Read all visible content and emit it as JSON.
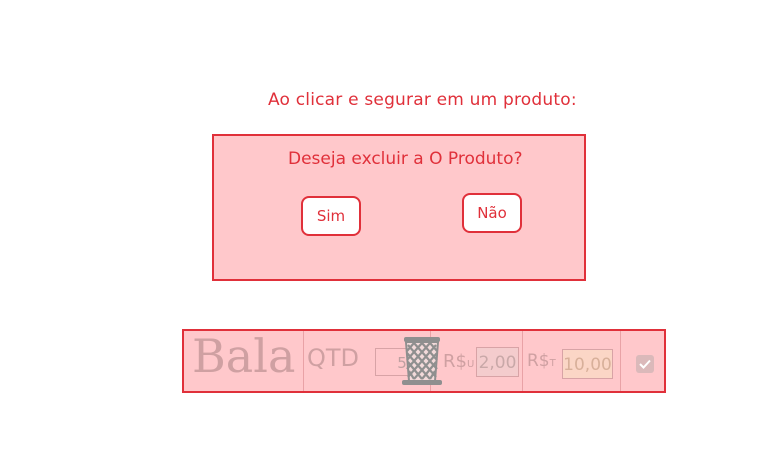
{
  "caption": "Ao clicar e segurar em um produto:",
  "dialog": {
    "question": "Deseja excluir a O Produto?",
    "yes_label": "Sim",
    "no_label": "Não"
  },
  "product_row": {
    "name": "Bala",
    "qty_label": "QTD",
    "qty_value": "5",
    "unit_label": "R$",
    "unit_sub": "U",
    "unit_price": "2,00",
    "total_label": "R$",
    "total_sub": "T",
    "total_price": "10,00",
    "checked": true
  },
  "colors": {
    "accent": "#e0303a",
    "panel_bg": "#ffc8cb",
    "trash_icon": "#8f8f8f"
  }
}
